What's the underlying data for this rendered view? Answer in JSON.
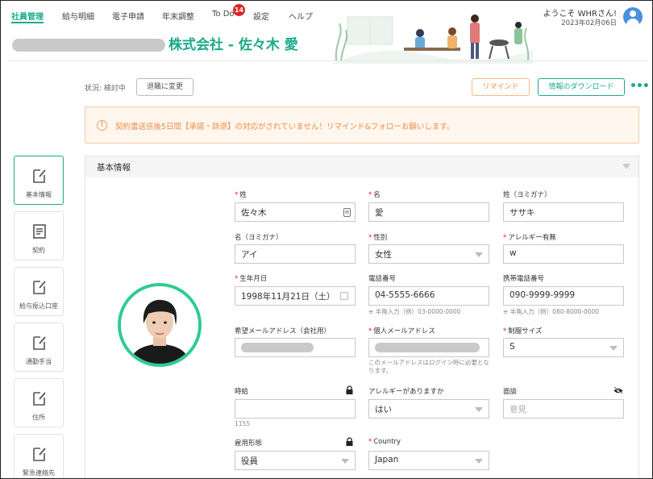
{
  "nav": {
    "items": [
      "社員管理",
      "給与明細",
      "電子申請",
      "年末調整",
      "To Do",
      "設定",
      "ヘルプ"
    ],
    "todo_badge": "14"
  },
  "user": {
    "welcome": "ようこそ WHRさん!",
    "date": "2023年02月06日"
  },
  "company": {
    "name_suffix": "株式会社 - 佐々木 愛"
  },
  "status": {
    "text": "状況: 検討中",
    "retire_button": "退職に変更"
  },
  "actions": {
    "remind": "リマインド",
    "download": "情報のダウンロード",
    "more": "•••"
  },
  "alert": {
    "icon": "!",
    "text": "契約書送信後5日間【承諾・辞退】の対応がされていません！リマインド&フォローお願いします。"
  },
  "sidebar": [
    "基本情報",
    "契約",
    "給与振込口座",
    "通勤手当",
    "住所",
    "緊急連絡先"
  ],
  "panel": {
    "title": "基本情報"
  },
  "fields": {
    "last_name": {
      "label": "姓",
      "value": "佐々木"
    },
    "first_name": {
      "label": "名",
      "value": "愛"
    },
    "last_kana": {
      "label": "姓（ヨミガナ）",
      "value": "ササキ"
    },
    "first_kana": {
      "label": "名（ヨミガナ）",
      "value": "アイ"
    },
    "gender": {
      "label": "性別",
      "value": "女性"
    },
    "allergy_flag": {
      "label": "アレルギー有無",
      "value": "w"
    },
    "birthday": {
      "label": "生年月日",
      "value": "1998年11月21日（土）"
    },
    "phone": {
      "label": "電話番号",
      "value": "04-5555-6666",
      "hint": "半角入力（例）03-0000-0000"
    },
    "mobile": {
      "label": "携帯電話番号",
      "value": "090-9999-9999",
      "hint": "半角入力（例）080-8000-0000"
    },
    "company_email": {
      "label": "希望メールアドレス（会社用）"
    },
    "personal_email": {
      "label": "個人メールアドレス",
      "hint": "このメールアドレスはログイン時に必要となります。"
    },
    "uniform_size": {
      "label": "制服サイズ",
      "value": "S"
    },
    "hourly_wage": {
      "label": "時給",
      "hint": "1155"
    },
    "allergy_question": {
      "label": "アレルギーがありますか",
      "value": "はい"
    },
    "interview": {
      "label": "面談",
      "placeholder": "意見"
    },
    "employment_type": {
      "label": "雇用形態",
      "value": "役員"
    },
    "country": {
      "label": "Country",
      "value": "Japan"
    }
  },
  "colors": {
    "accent": "#1aab8a",
    "warning": "#f08c45",
    "required": "#e0232a",
    "badge": "#e0232a"
  }
}
